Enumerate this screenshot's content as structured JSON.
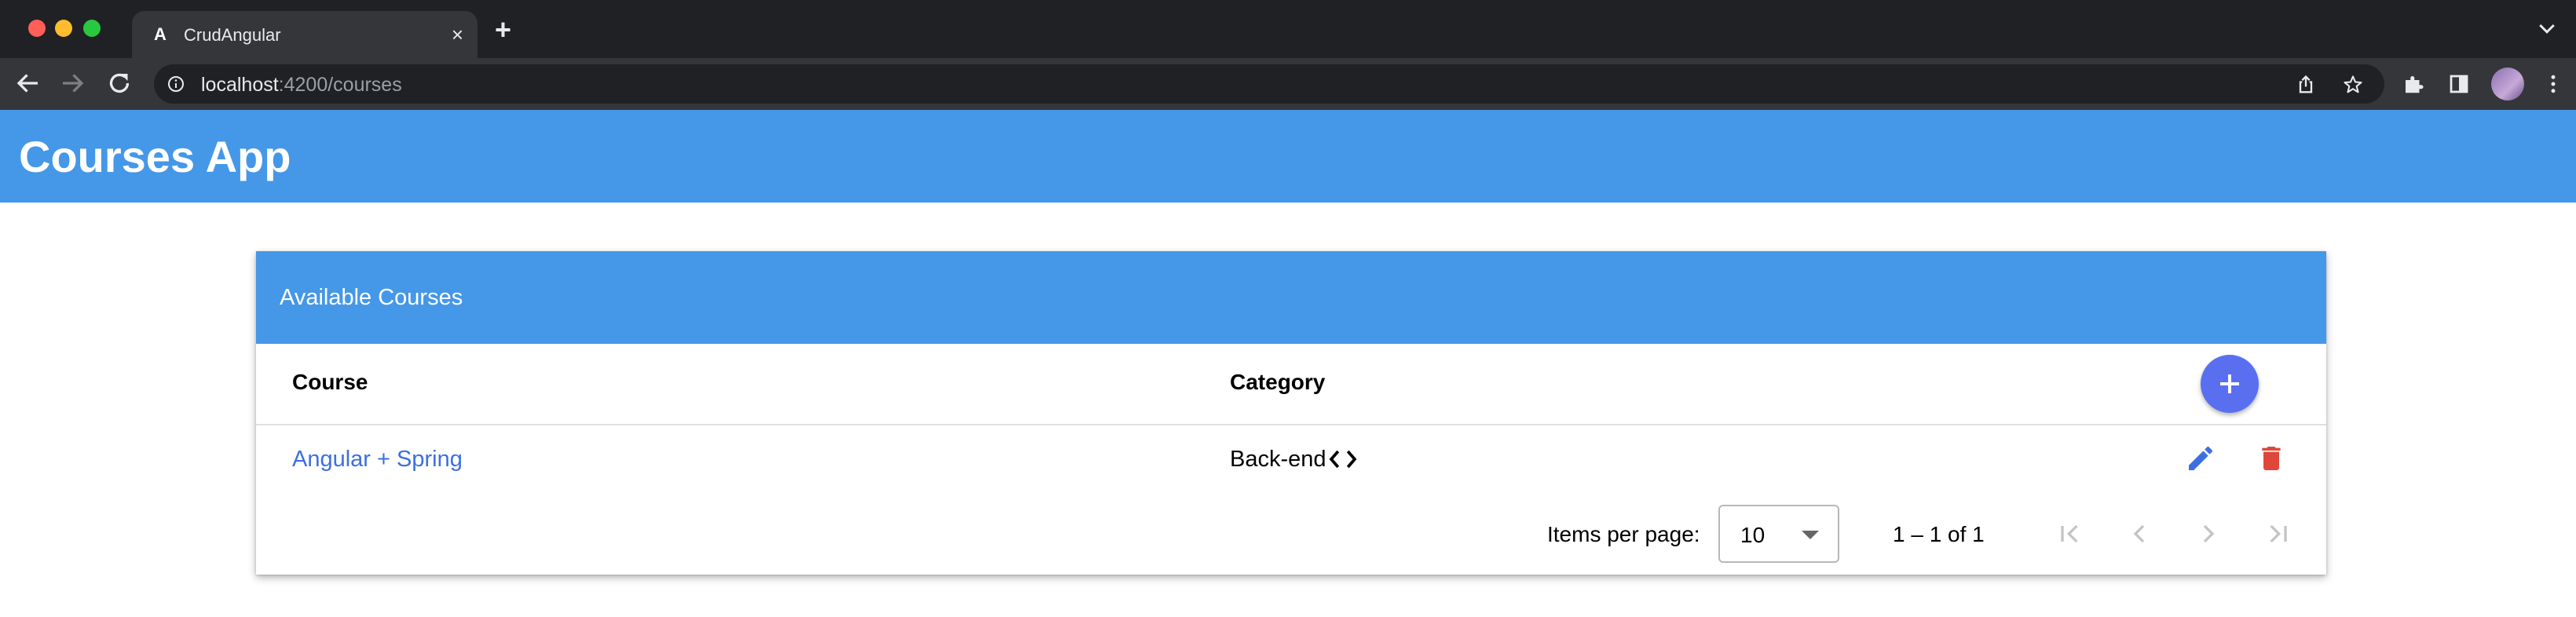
{
  "browser": {
    "tab_title": "CrudAngular",
    "tab_favicon": "A",
    "tab_close_glyph": "×",
    "new_tab_glyph": "+",
    "url_host": "localhost",
    "url_rest": ":4200/courses"
  },
  "app": {
    "title": "Courses App"
  },
  "card": {
    "title": "Available Courses"
  },
  "table": {
    "columns": [
      "Course",
      "Category"
    ],
    "rows": [
      {
        "course": "Angular + Spring",
        "category": "Back-end",
        "category_icon": "code-icon"
      }
    ]
  },
  "paginator": {
    "items_per_page_label": "Items per page:",
    "page_size": "10",
    "range_label": "1 – 1 of 1"
  },
  "colors": {
    "primary": "#4597e8",
    "fab": "#5a6ff0",
    "link": "#3d6fe0",
    "edit": "#3d6fe0",
    "delete": "#e0473a"
  }
}
